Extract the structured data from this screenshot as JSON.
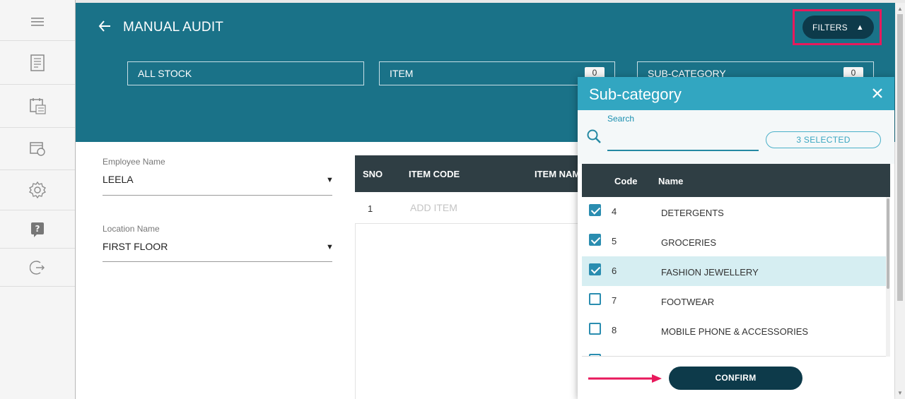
{
  "header": {
    "title": "MANUAL AUDIT",
    "filters_label": "FILTERS",
    "filter_boxes": [
      {
        "label": "ALL STOCK",
        "count": ""
      },
      {
        "label": "ITEM",
        "count": "0"
      },
      {
        "label": "SUB-CATEGORY",
        "count": "0"
      }
    ]
  },
  "sidebar": {
    "icons": [
      "menu-icon",
      "report-icon",
      "calendar-icon",
      "history-icon",
      "settings-icon",
      "help-icon",
      "logout-icon"
    ]
  },
  "form": {
    "employee": {
      "label": "Employee Name",
      "value": "LEELA"
    },
    "location": {
      "label": "Location Name",
      "value": "FIRST FLOOR"
    }
  },
  "table": {
    "headers": [
      "SNO",
      "ITEM CODE",
      "ITEM NAM"
    ],
    "rows": [
      {
        "sno": "1",
        "item_code_placeholder": "ADD ITEM"
      }
    ]
  },
  "modal": {
    "title": "Sub-category",
    "search_label": "Search",
    "search_value": "",
    "selected_label": "3 SELECTED",
    "columns": {
      "code": "Code",
      "name": "Name"
    },
    "rows": [
      {
        "code": "4",
        "name": "DETERGENTS",
        "checked": true
      },
      {
        "code": "5",
        "name": "GROCERIES",
        "checked": true
      },
      {
        "code": "6",
        "name": "FASHION JEWELLERY",
        "checked": true,
        "highlighted": true
      },
      {
        "code": "7",
        "name": "FOOTWEAR",
        "checked": false
      },
      {
        "code": "8",
        "name": "MOBILE PHONE & ACCESSORIES",
        "checked": false
      }
    ],
    "confirm_label": "CONFIRM"
  },
  "colors": {
    "header_bg": "#1a7288",
    "modal_header": "#32a6c1",
    "dark_button": "#0d3a4a",
    "highlight": "#e8195c"
  }
}
